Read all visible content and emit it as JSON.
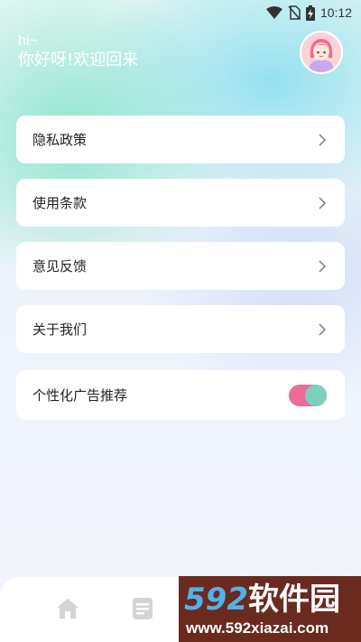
{
  "status_bar": {
    "time": "10:12",
    "icons": [
      "wifi-icon",
      "no-sim-icon",
      "battery-charging-icon"
    ]
  },
  "header": {
    "greeting": "hi~",
    "welcome": "你好呀!欢迎回来",
    "avatar_icon": "girl-avatar-icon"
  },
  "menu": {
    "privacy": "隐私政策",
    "terms": "使用条款",
    "feedback": "意见反馈",
    "about": "关于我们",
    "personalized_ads": "个性化广告推荐",
    "personalized_ads_enabled": true
  },
  "tabbar": {
    "icons": [
      "home-icon",
      "notes-icon"
    ]
  },
  "watermark": {
    "logo_number": "592",
    "logo_text": "软件园",
    "url": "www.592xiazai.com"
  },
  "colors": {
    "toggle_track": "#ee6b98",
    "toggle_knob": "#7cd0bd",
    "watermark_bg": "#6a2a1d",
    "watermark_number": "#4fb3ea"
  }
}
